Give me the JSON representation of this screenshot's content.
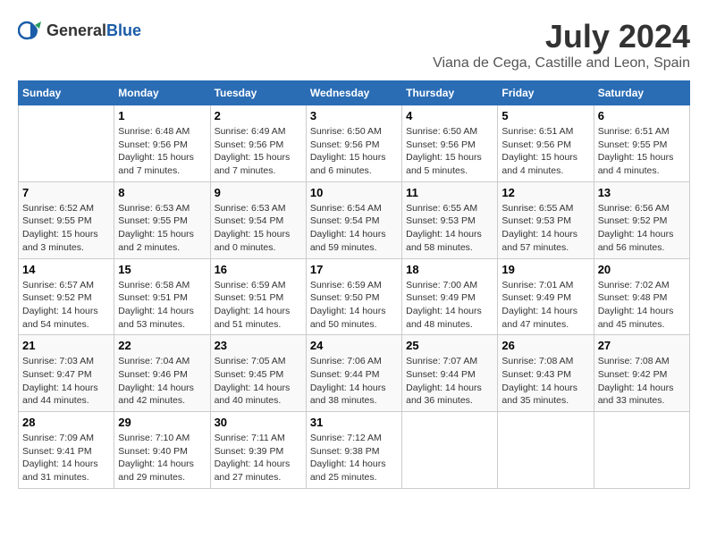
{
  "header": {
    "logo_general": "General",
    "logo_blue": "Blue",
    "month_year": "July 2024",
    "location": "Viana de Cega, Castille and Leon, Spain"
  },
  "days_of_week": [
    "Sunday",
    "Monday",
    "Tuesday",
    "Wednesday",
    "Thursday",
    "Friday",
    "Saturday"
  ],
  "weeks": [
    [
      {
        "day": "",
        "content": ""
      },
      {
        "day": "1",
        "content": "Sunrise: 6:48 AM\nSunset: 9:56 PM\nDaylight: 15 hours\nand 7 minutes."
      },
      {
        "day": "2",
        "content": "Sunrise: 6:49 AM\nSunset: 9:56 PM\nDaylight: 15 hours\nand 7 minutes."
      },
      {
        "day": "3",
        "content": "Sunrise: 6:50 AM\nSunset: 9:56 PM\nDaylight: 15 hours\nand 6 minutes."
      },
      {
        "day": "4",
        "content": "Sunrise: 6:50 AM\nSunset: 9:56 PM\nDaylight: 15 hours\nand 5 minutes."
      },
      {
        "day": "5",
        "content": "Sunrise: 6:51 AM\nSunset: 9:56 PM\nDaylight: 15 hours\nand 4 minutes."
      },
      {
        "day": "6",
        "content": "Sunrise: 6:51 AM\nSunset: 9:55 PM\nDaylight: 15 hours\nand 4 minutes."
      }
    ],
    [
      {
        "day": "7",
        "content": "Sunrise: 6:52 AM\nSunset: 9:55 PM\nDaylight: 15 hours\nand 3 minutes."
      },
      {
        "day": "8",
        "content": "Sunrise: 6:53 AM\nSunset: 9:55 PM\nDaylight: 15 hours\nand 2 minutes."
      },
      {
        "day": "9",
        "content": "Sunrise: 6:53 AM\nSunset: 9:54 PM\nDaylight: 15 hours\nand 0 minutes."
      },
      {
        "day": "10",
        "content": "Sunrise: 6:54 AM\nSunset: 9:54 PM\nDaylight: 14 hours\nand 59 minutes."
      },
      {
        "day": "11",
        "content": "Sunrise: 6:55 AM\nSunset: 9:53 PM\nDaylight: 14 hours\nand 58 minutes."
      },
      {
        "day": "12",
        "content": "Sunrise: 6:55 AM\nSunset: 9:53 PM\nDaylight: 14 hours\nand 57 minutes."
      },
      {
        "day": "13",
        "content": "Sunrise: 6:56 AM\nSunset: 9:52 PM\nDaylight: 14 hours\nand 56 minutes."
      }
    ],
    [
      {
        "day": "14",
        "content": "Sunrise: 6:57 AM\nSunset: 9:52 PM\nDaylight: 14 hours\nand 54 minutes."
      },
      {
        "day": "15",
        "content": "Sunrise: 6:58 AM\nSunset: 9:51 PM\nDaylight: 14 hours\nand 53 minutes."
      },
      {
        "day": "16",
        "content": "Sunrise: 6:59 AM\nSunset: 9:51 PM\nDaylight: 14 hours\nand 51 minutes."
      },
      {
        "day": "17",
        "content": "Sunrise: 6:59 AM\nSunset: 9:50 PM\nDaylight: 14 hours\nand 50 minutes."
      },
      {
        "day": "18",
        "content": "Sunrise: 7:00 AM\nSunset: 9:49 PM\nDaylight: 14 hours\nand 48 minutes."
      },
      {
        "day": "19",
        "content": "Sunrise: 7:01 AM\nSunset: 9:49 PM\nDaylight: 14 hours\nand 47 minutes."
      },
      {
        "day": "20",
        "content": "Sunrise: 7:02 AM\nSunset: 9:48 PM\nDaylight: 14 hours\nand 45 minutes."
      }
    ],
    [
      {
        "day": "21",
        "content": "Sunrise: 7:03 AM\nSunset: 9:47 PM\nDaylight: 14 hours\nand 44 minutes."
      },
      {
        "day": "22",
        "content": "Sunrise: 7:04 AM\nSunset: 9:46 PM\nDaylight: 14 hours\nand 42 minutes."
      },
      {
        "day": "23",
        "content": "Sunrise: 7:05 AM\nSunset: 9:45 PM\nDaylight: 14 hours\nand 40 minutes."
      },
      {
        "day": "24",
        "content": "Sunrise: 7:06 AM\nSunset: 9:44 PM\nDaylight: 14 hours\nand 38 minutes."
      },
      {
        "day": "25",
        "content": "Sunrise: 7:07 AM\nSunset: 9:44 PM\nDaylight: 14 hours\nand 36 minutes."
      },
      {
        "day": "26",
        "content": "Sunrise: 7:08 AM\nSunset: 9:43 PM\nDaylight: 14 hours\nand 35 minutes."
      },
      {
        "day": "27",
        "content": "Sunrise: 7:08 AM\nSunset: 9:42 PM\nDaylight: 14 hours\nand 33 minutes."
      }
    ],
    [
      {
        "day": "28",
        "content": "Sunrise: 7:09 AM\nSunset: 9:41 PM\nDaylight: 14 hours\nand 31 minutes."
      },
      {
        "day": "29",
        "content": "Sunrise: 7:10 AM\nSunset: 9:40 PM\nDaylight: 14 hours\nand 29 minutes."
      },
      {
        "day": "30",
        "content": "Sunrise: 7:11 AM\nSunset: 9:39 PM\nDaylight: 14 hours\nand 27 minutes."
      },
      {
        "day": "31",
        "content": "Sunrise: 7:12 AM\nSunset: 9:38 PM\nDaylight: 14 hours\nand 25 minutes."
      },
      {
        "day": "",
        "content": ""
      },
      {
        "day": "",
        "content": ""
      },
      {
        "day": "",
        "content": ""
      }
    ]
  ]
}
